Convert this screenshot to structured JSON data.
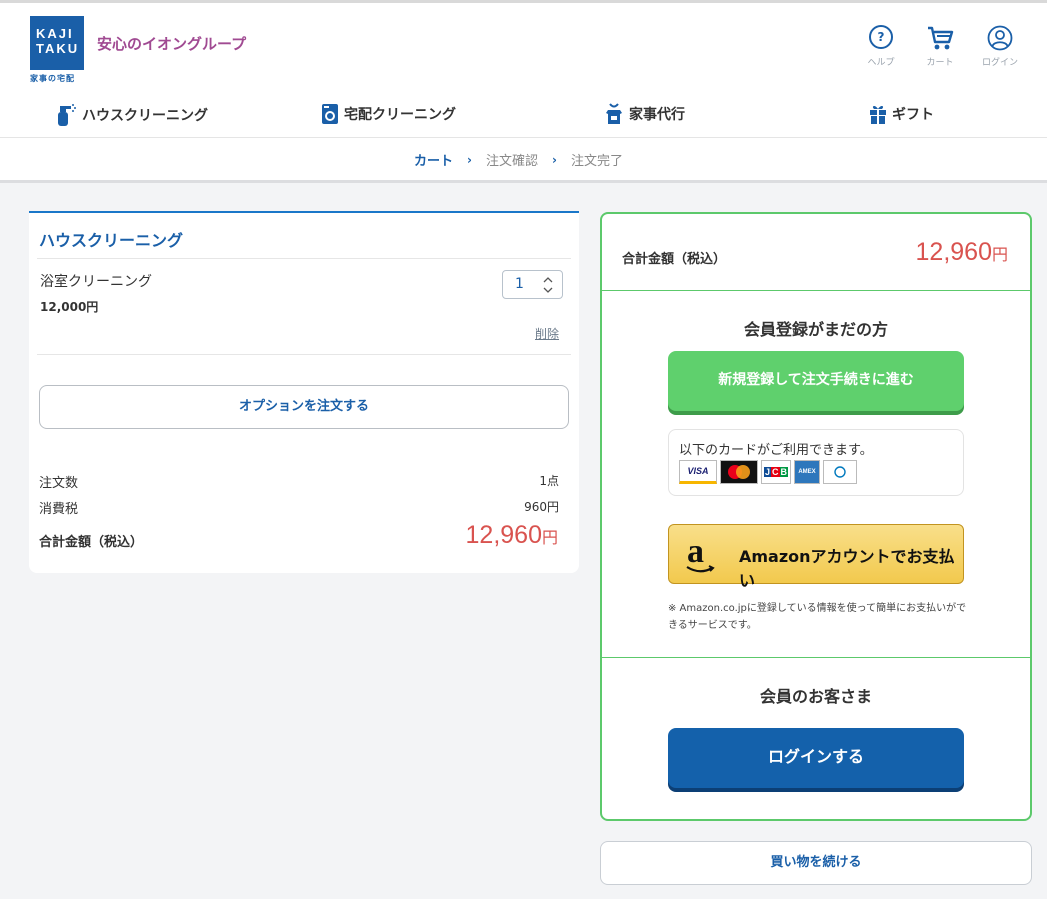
{
  "brand": {
    "logo_line1": "KAJI",
    "logo_line2": "TAKU",
    "logo_sub": "家事の宅配",
    "tagline": "安心のイオングループ"
  },
  "header_icons": [
    {
      "icon": "help-icon",
      "label": "ヘルプ"
    },
    {
      "icon": "cart-icon",
      "label": "カート"
    },
    {
      "icon": "user-icon",
      "label": "ログイン"
    }
  ],
  "nav": [
    {
      "icon": "spray-bottle-icon",
      "label": "ハウスクリーニング"
    },
    {
      "icon": "washing-machine-icon",
      "label": "宅配クリーニング"
    },
    {
      "icon": "apron-icon",
      "label": "家事代行"
    },
    {
      "icon": "gift-icon",
      "label": "ギフト"
    }
  ],
  "breadcrumb": {
    "steps": [
      "カート",
      "注文確認",
      "注文完了"
    ],
    "separator": "›",
    "current_index": 0
  },
  "cart": {
    "title": "ハウスクリーニング",
    "item": {
      "name": "浴室クリーニング",
      "price": "12,000円",
      "quantity": "1",
      "delete_label": "削除"
    },
    "option_button": "オプションを注文する",
    "summary": {
      "count_label": "注文数",
      "count_value": "1点",
      "tax_label": "消費税",
      "tax_value": "960円",
      "total_label": "合計金額（税込）",
      "total_value": "12,960",
      "total_unit": "円"
    }
  },
  "checkout": {
    "total_label": "合計金額（税込）",
    "total_value": "12,960",
    "total_unit": "円",
    "guest_heading": "会員登録がまだの方",
    "register_button": "新規登録して注文手続きに進む",
    "cards_text": "以下のカードがご利用できます。",
    "cards": [
      "VISA",
      "mastercard",
      "JCB",
      "AMEX",
      "Diners Club"
    ],
    "amazon_button": "Amazonアカウントでお支払い",
    "amazon_note": "※ Amazon.co.jpに登録している情報を使って簡単にお支払いができるサービスです。",
    "member_heading": "会員のお客さま",
    "login_button": "ログインする"
  },
  "continue_button": "買い物を続ける",
  "colors": {
    "brand_blue": "#1a5fa8",
    "price_red": "#d9534f",
    "green": "#5fd06d",
    "login_blue": "#1461ab",
    "tagline_purple": "#a04a92"
  }
}
